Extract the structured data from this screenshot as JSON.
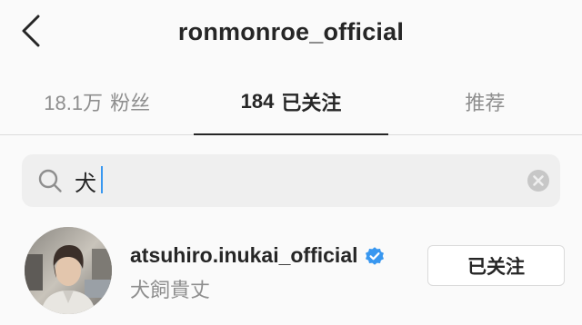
{
  "header": {
    "title": "ronmonroe_official",
    "back_icon": "chevron-left-icon"
  },
  "tabs": [
    {
      "count": "18.1万",
      "label": "粉丝",
      "active": false
    },
    {
      "count": "184",
      "label": "已关注",
      "active": true
    },
    {
      "count": "",
      "label": "推荐",
      "active": false
    }
  ],
  "search": {
    "value": "犬",
    "icon": "search-icon",
    "clear_icon": "clear-icon"
  },
  "results": [
    {
      "username": "atsuhiro.inukai_official",
      "full_name": "犬飼貴丈",
      "verified": true,
      "follow_label": "已关注"
    }
  ],
  "colors": {
    "background": "#fafafa",
    "search_bg": "#efefef",
    "verified_blue": "#3897f0",
    "text_primary": "#262626",
    "text_secondary": "#8e8e8e",
    "border": "#dbdbdb"
  }
}
